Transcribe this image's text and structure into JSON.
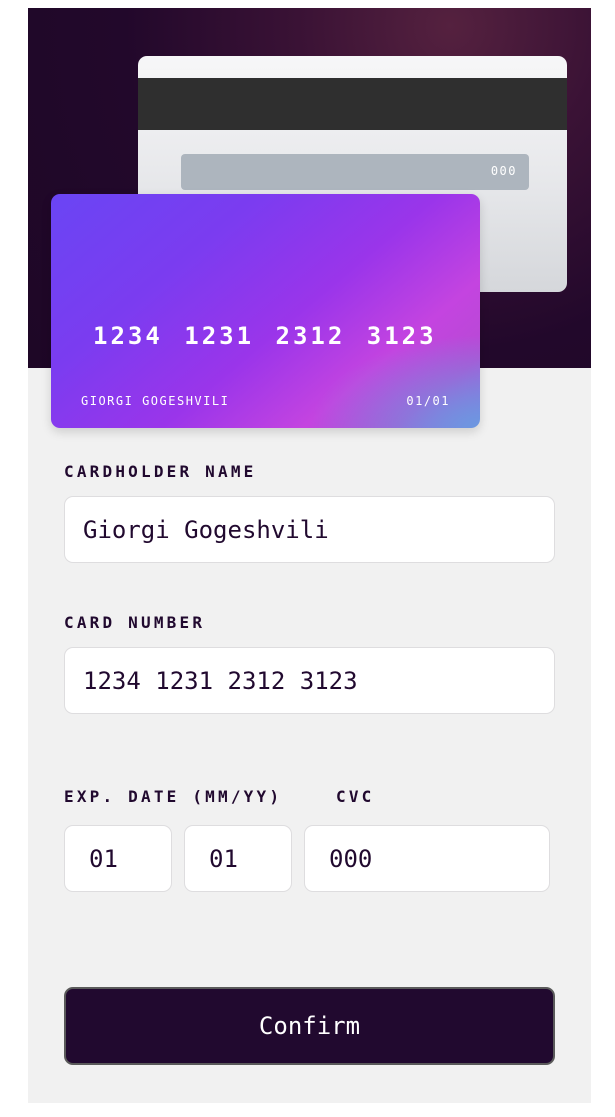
{
  "card_back": {
    "cvc": "000"
  },
  "card_front": {
    "number": "1234 1231 2312 3123",
    "holder": "GIORGI GOGESHVILI",
    "expiry": "01/01"
  },
  "form": {
    "name_label": "CARDHOLDER NAME",
    "name_value": "Giorgi Gogeshvili",
    "number_label": "CARD NUMBER",
    "number_value": "1234 1231 2312 3123",
    "exp_label": "EXP. DATE (MM/YY)",
    "cvc_label": "CVC",
    "exp_month_value": "01",
    "exp_year_value": "01",
    "cvc_value": "000",
    "confirm_label": "Confirm"
  },
  "colors": {
    "dark_violet": "#21092f",
    "card_gradient_start": "#6a45f4",
    "card_gradient_end": "#c444e0",
    "background": "#f1f1f1"
  }
}
